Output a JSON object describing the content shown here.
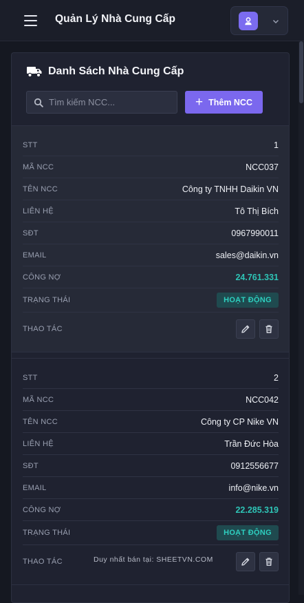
{
  "header": {
    "title": "Quản Lý Nhà Cung Cấp",
    "menu_icon": "hamburger-menu-icon",
    "user_icon": "user-avatar-icon",
    "dropdown_icon": "chevron-down-icon",
    "accent_color": "#7b68ee"
  },
  "panel": {
    "title": "Danh Sách Nhà Cung Cấp",
    "title_icon": "truck-icon",
    "search_placeholder": "Tìm kiếm NCC...",
    "add_button_label": "Thêm NCC"
  },
  "labels": {
    "stt": "STT",
    "code": "MÃ NCC",
    "name": "TÊN NCC",
    "contact": "LIÊN HỆ",
    "phone": "SĐT",
    "email": "EMAIL",
    "debt": "CÔNG NỢ",
    "status": "TRẠNG THÁI",
    "actions": "THAO TÁC"
  },
  "suppliers": [
    {
      "stt": "1",
      "code": "NCC037",
      "name": "Công ty TNHH Daikin VN",
      "contact": "Tô Thị Bích",
      "phone": "0967990011",
      "email": "sales@daikin.vn",
      "debt": "24.761.331",
      "status": "HOẠT ĐỘNG"
    },
    {
      "stt": "2",
      "code": "NCC042",
      "name": "Công ty CP Nike VN",
      "contact": "Trần Đức Hòa",
      "phone": "0912556677",
      "email": "info@nike.vn",
      "debt": "22.285.319",
      "status": "HOẠT ĐỘNG"
    }
  ],
  "watermark": "Duy nhất bán tại: SHEETVN.COM"
}
